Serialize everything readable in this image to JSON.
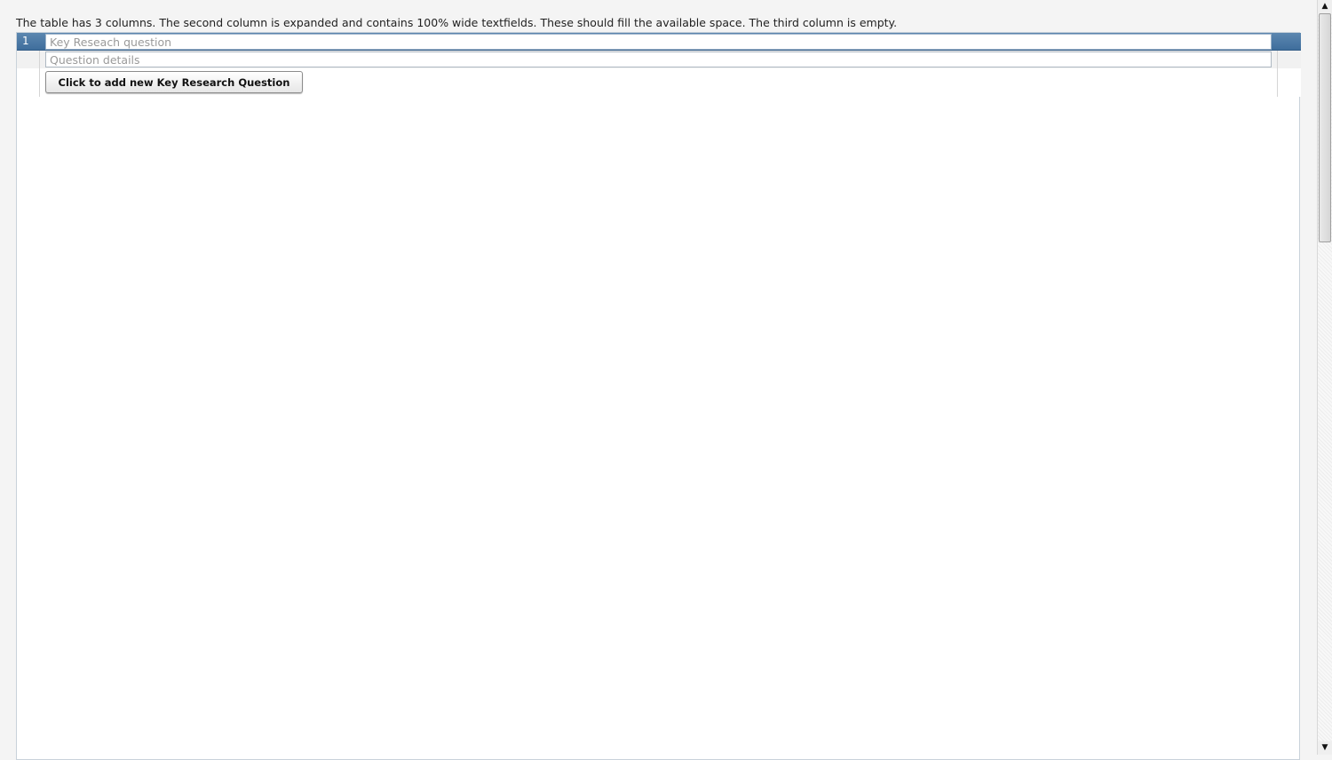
{
  "intro_text": "The table has 3 columns. The second column is expanded and contains 100% wide textfields. These should fill the available space. The third column is empty.",
  "table": {
    "row_number": "1",
    "question_field": {
      "value": "",
      "placeholder": "Key Reseach question"
    },
    "details_field": {
      "value": "",
      "placeholder": "Question details"
    },
    "add_button_label": "Click to add new Key Research Question"
  },
  "scrollbar": {
    "up_arrow": "▲",
    "down_arrow": "▼"
  },
  "colors": {
    "header_row": "#4a7aa6",
    "alt_row": "#f1f1f1",
    "background": "#f4f4f4"
  }
}
